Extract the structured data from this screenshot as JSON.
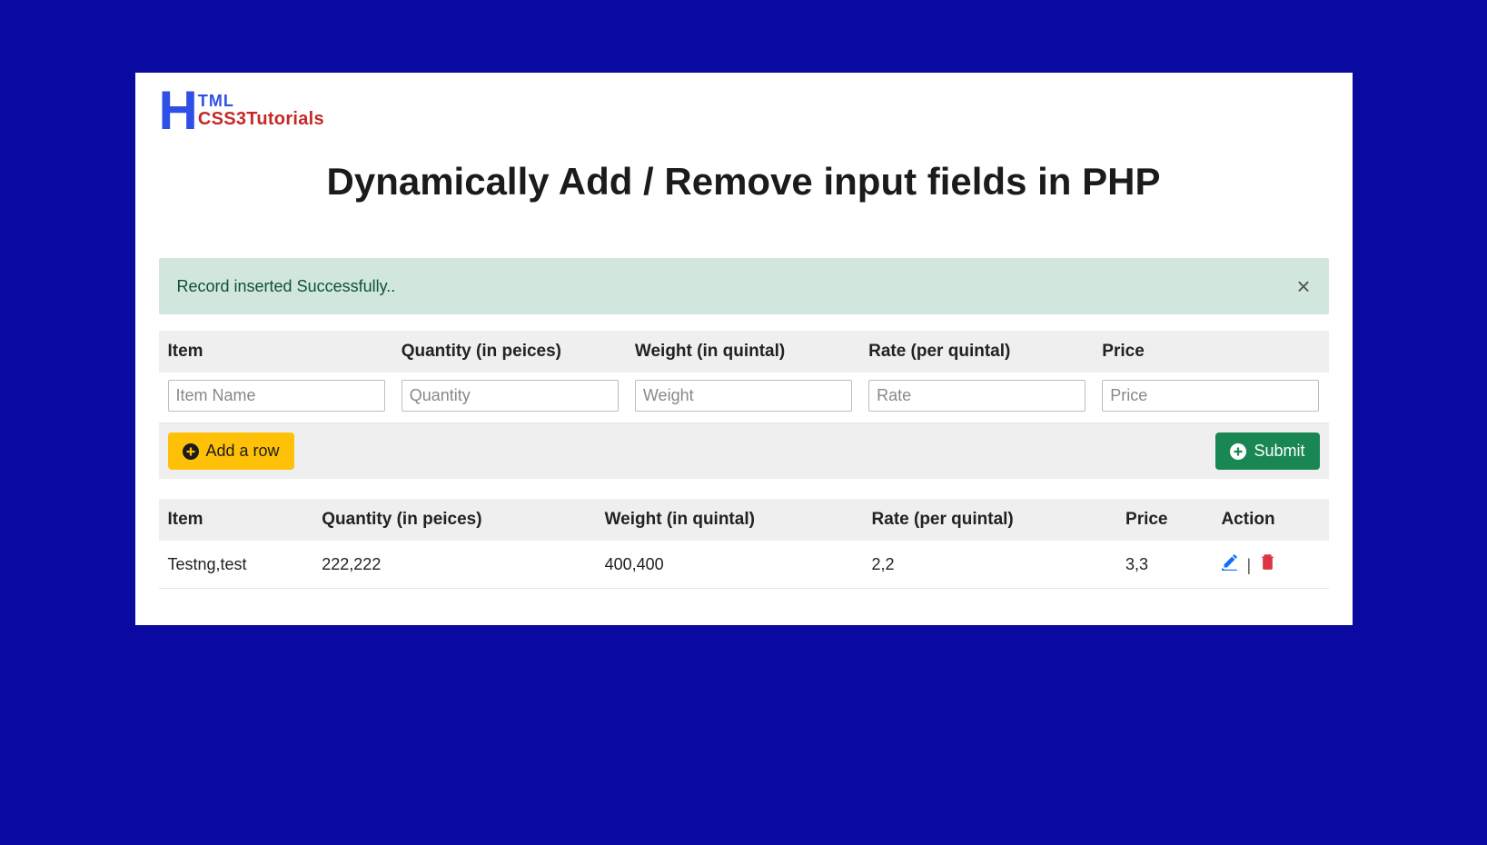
{
  "logo": {
    "h": "H",
    "tml": "TML",
    "css3": "CSS3Tutorials"
  },
  "title": "Dynamically Add / Remove input fields in PHP",
  "alert": {
    "message": "Record inserted Successfully..",
    "close_label": "×"
  },
  "form": {
    "headers": {
      "item": "Item",
      "quantity": "Quantity (in peices)",
      "weight": "Weight (in quintal)",
      "rate": "Rate (per quintal)",
      "price": "Price"
    },
    "placeholders": {
      "item": "Item Name",
      "quantity": "Quantity",
      "weight": "Weight",
      "rate": "Rate",
      "price": "Price"
    },
    "add_row_label": "Add a row",
    "submit_label": "Submit"
  },
  "data_headers": {
    "item": "Item",
    "quantity": "Quantity (in peices)",
    "weight": "Weight (in quintal)",
    "rate": "Rate (per quintal)",
    "price": "Price",
    "action": "Action"
  },
  "rows": [
    {
      "item": "Testng,test",
      "quantity": "222,222",
      "weight": "400,400",
      "rate": "2,2",
      "price": "3,3"
    }
  ],
  "action_separator": "|"
}
